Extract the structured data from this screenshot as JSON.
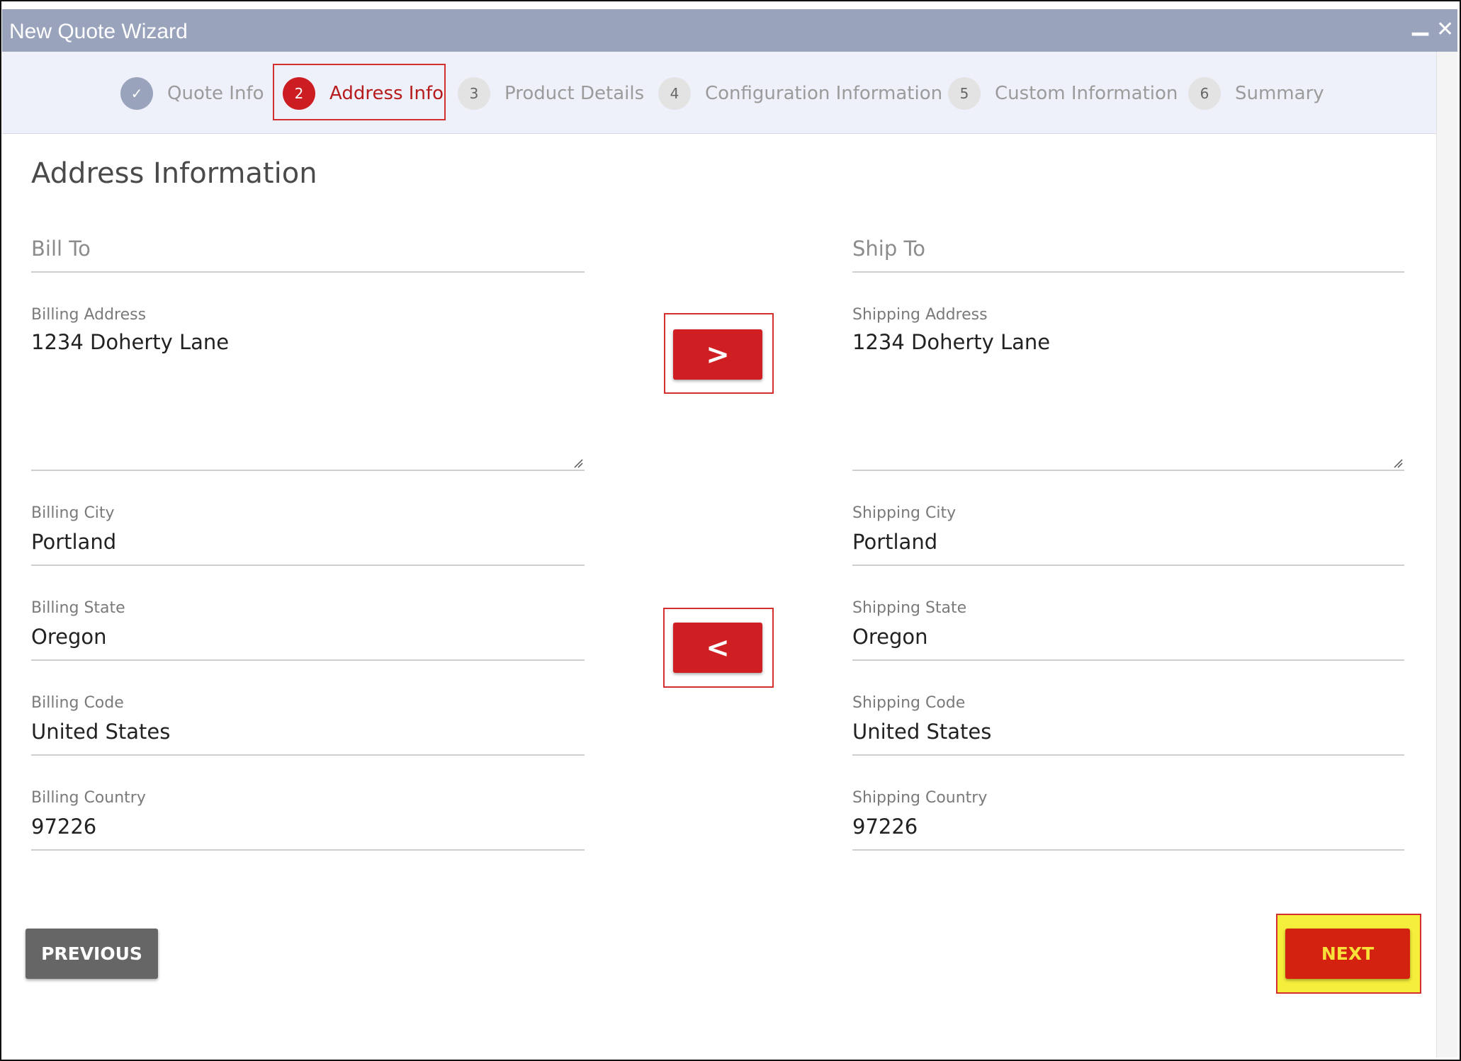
{
  "window": {
    "title": "New Quote Wizard",
    "minimize_glyph": "▁",
    "close_glyph": "✕"
  },
  "steps": [
    {
      "number": "✓",
      "label": "Quote Info",
      "state": "done"
    },
    {
      "number": "2",
      "label": "Address Info",
      "state": "active"
    },
    {
      "number": "3",
      "label": "Product Details",
      "state": "pending"
    },
    {
      "number": "4",
      "label": "Configuration Information",
      "state": "pending"
    },
    {
      "number": "5",
      "label": "Custom Information",
      "state": "pending"
    },
    {
      "number": "6",
      "label": "Summary",
      "state": "pending"
    }
  ],
  "section_title": "Address Information",
  "bill_to": {
    "heading": "Bill To",
    "address_label": "Billing Address",
    "address_value": "1234 Doherty Lane",
    "city_label": "Billing City",
    "city_value": "Portland",
    "state_label": "Billing State",
    "state_value": "Oregon",
    "code_label": "Billing Code",
    "code_value": "United States",
    "country_label": "Billing Country",
    "country_value": "97226"
  },
  "ship_to": {
    "heading": "Ship To",
    "address_label": "Shipping Address",
    "address_value": "1234 Doherty Lane",
    "city_label": "Shipping City",
    "city_value": "Portland",
    "state_label": "Shipping State",
    "state_value": "Oregon",
    "code_label": "Shipping Code",
    "code_value": "United States",
    "country_label": "Shipping Country",
    "country_value": "97226"
  },
  "copy_buttons": {
    "to_shipping": ">",
    "to_billing": "<"
  },
  "footer": {
    "previous_label": "PREVIOUS",
    "next_label": "NEXT"
  },
  "colors": {
    "title_bar": "#9aa3bc",
    "accent_red": "#d01f22",
    "highlight_yellow": "#f5ee3c"
  }
}
